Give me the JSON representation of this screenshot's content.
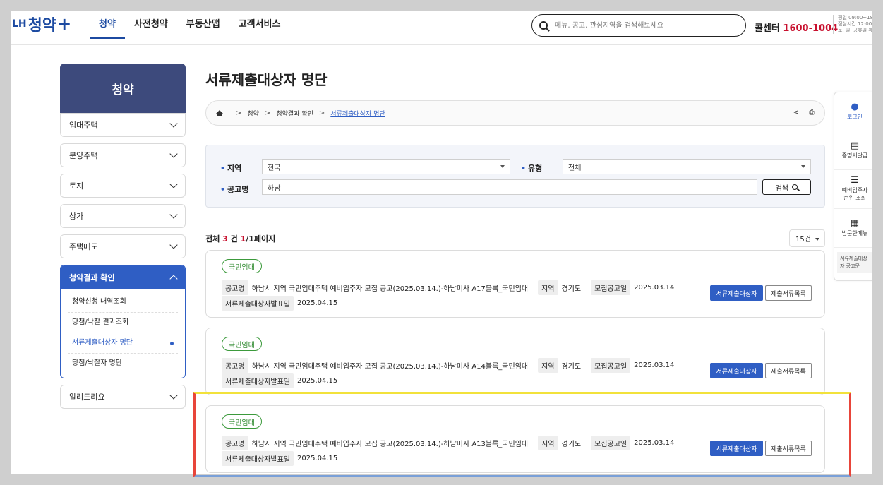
{
  "header": {
    "logo_lh": "LH",
    "logo_brand": "청약",
    "logo_plus": "+",
    "nav": [
      "청약",
      "사전청약",
      "부동산맵",
      "고객서비스"
    ],
    "search_placeholder": "메뉴, 공고, 관심지역을 검색해보세요",
    "call_label": "콜센터",
    "call_number": "1600-1004",
    "hours_line1": "평일 09:00~18:00",
    "hours_line2": "점심시간 12:00~13:00",
    "hours_line3": "토, 일, 공휴일 휴무"
  },
  "sidebar": {
    "title": "청약",
    "items_top": [
      "임대주택",
      "분양주택",
      "토지",
      "상가",
      "주택매도"
    ],
    "open_section": "청약결과 확인",
    "sub_items": [
      "청약신청 내역조회",
      "당첨/낙찰 결과조회",
      "서류제출대상자 명단",
      "당첨/낙찰자 명단"
    ],
    "active_sub_index": 2,
    "items_bottom": [
      "알려드려요"
    ]
  },
  "main": {
    "title": "서류제출대상자 명단",
    "breadcrumb": [
      "청약",
      "청약결과 확인",
      "서류제출대상자 명단"
    ],
    "share_icon": "<",
    "print_icon": "⎙",
    "filter": {
      "region_label": "지역",
      "region_value": "전국",
      "type_label": "유형",
      "type_value": "전체",
      "name_label": "공고명",
      "name_value": "하남",
      "search_button": "검색"
    },
    "summary": {
      "prefix": "전체",
      "count": "3",
      "unit": "건",
      "page_current": "1",
      "page_rest": "/1페이지"
    },
    "page_size": "15건",
    "card_labels": {
      "name": "공고명",
      "region": "지역",
      "notice_date": "모집공고일",
      "announce_date": "서류제출대상자발표일",
      "primary_button": "서류제출대상자",
      "secondary_button": "제출서류목록"
    },
    "results": [
      {
        "badge": "국민임대",
        "title": "하남시 지역 국민임대주택 예비입주자 모집 공고(2025.03.14.)-하남미사 A17블록_국민임대",
        "region": "경기도",
        "notice_date": "2025.03.14",
        "announce_date": "2025.04.15"
      },
      {
        "badge": "국민임대",
        "title": "하남시 지역 국민임대주택 예비입주자 모집 공고(2025.03.14.)-하남미사 A14블록_국민임대",
        "region": "경기도",
        "notice_date": "2025.03.14",
        "announce_date": "2025.04.15"
      },
      {
        "badge": "국민임대",
        "title": "하남시 지역 국민임대주택 예비입주자 모집 공고(2025.03.14.)-하남미사 A13블록_국민임대",
        "region": "경기도",
        "notice_date": "2025.03.14",
        "announce_date": "2025.04.15"
      }
    ]
  },
  "quick_menu": {
    "items": [
      "로그인",
      "증명서발급",
      "예비입주자 순위 조회",
      "방문한메뉴"
    ],
    "icons": [
      "person-icon",
      "document-icon",
      "list-icon",
      "grid-icon"
    ],
    "recent": "서류제출대상자 공고문"
  }
}
